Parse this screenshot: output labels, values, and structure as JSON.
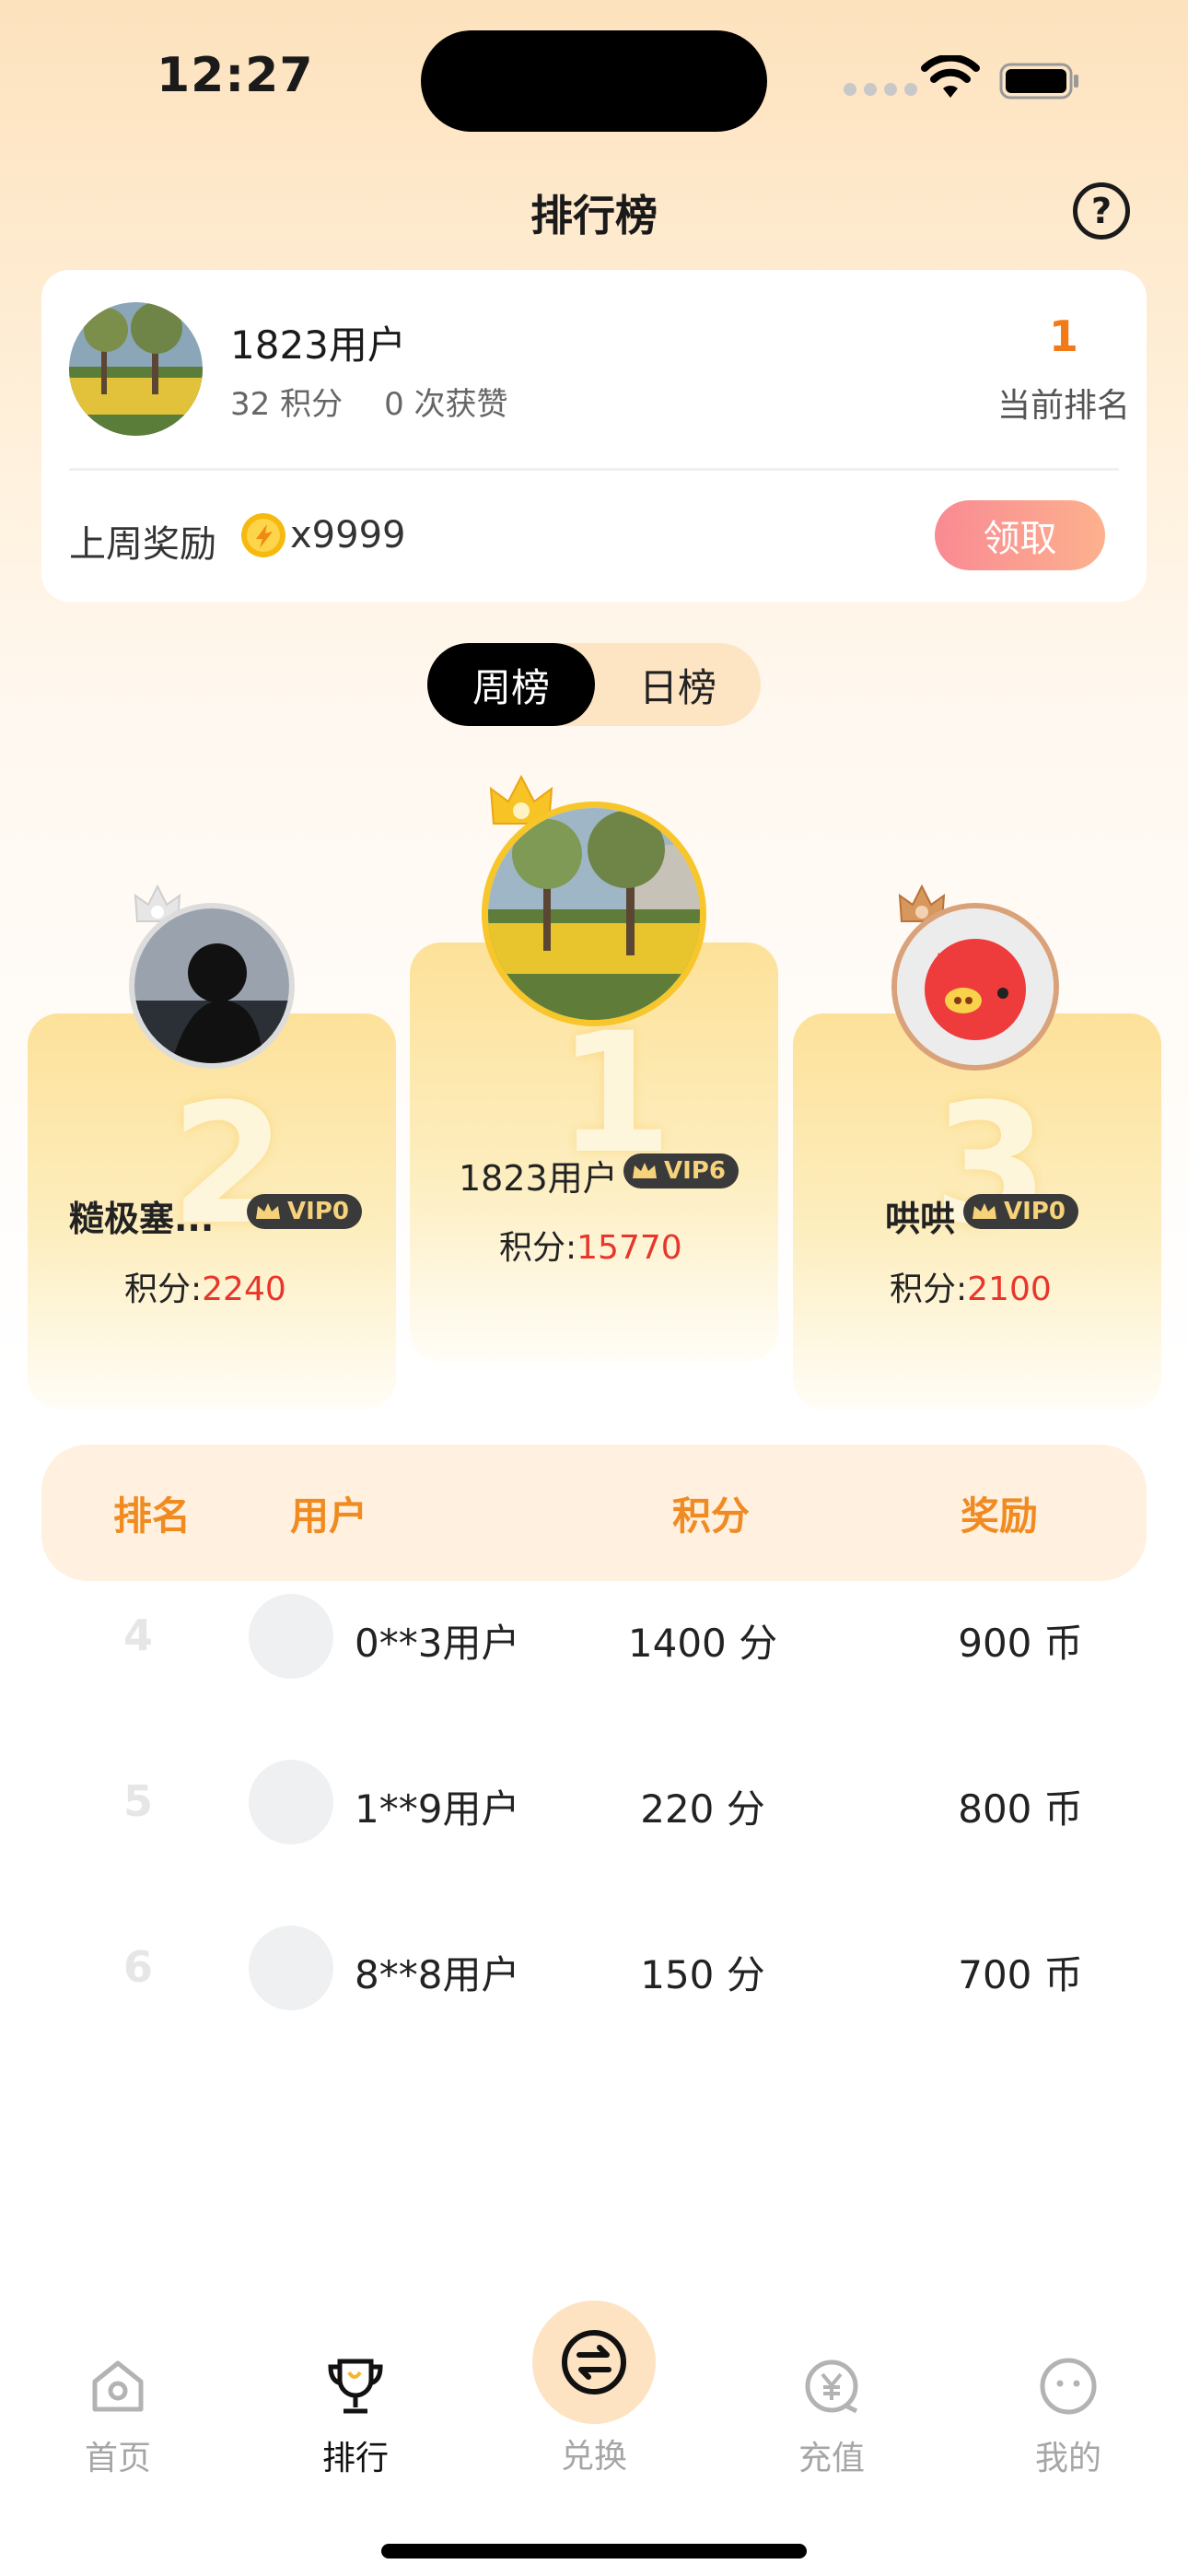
{
  "status": {
    "time": "12:27"
  },
  "header": {
    "title": "排行榜",
    "help_icon": "?"
  },
  "me": {
    "name": "1823用户",
    "points": "32 积分",
    "likes": "0 次获赞",
    "rank": "1",
    "rank_label": "当前排名",
    "reward_label": "上周奖励",
    "reward_value": "x9999",
    "claim_label": "领取"
  },
  "tabs": {
    "weekly": "周榜",
    "daily": "日榜",
    "active": "weekly"
  },
  "podium": [
    {
      "place": "2",
      "name": "糙极塞...",
      "vip": "VIP0",
      "score_label": "积分:",
      "score": "2240"
    },
    {
      "place": "1",
      "name": "1823用户",
      "vip": "VIP6",
      "score_label": "积分:",
      "score": "15770"
    },
    {
      "place": "3",
      "name": "哄哄",
      "vip": "VIP0",
      "score_label": "积分:",
      "score": "2100"
    }
  ],
  "table": {
    "headers": {
      "rank": "排名",
      "user": "用户",
      "score": "积分",
      "reward": "奖励"
    },
    "rows": [
      {
        "rank": "4",
        "user": "0**3用户",
        "score": "1400 分",
        "reward": "900 币"
      },
      {
        "rank": "5",
        "user": "1**9用户",
        "score": "220 分",
        "reward": "800 币"
      },
      {
        "rank": "6",
        "user": "8**8用户",
        "score": "150 分",
        "reward": "700 币"
      }
    ]
  },
  "nav": {
    "home": "首页",
    "ranking": "排行",
    "exchange": "兑换",
    "recharge": "充值",
    "mine": "我的",
    "active": "ranking"
  },
  "colors": {
    "accent": "#f27a18",
    "score_red": "#e8362b",
    "vip_gold": "#f6d27a"
  }
}
